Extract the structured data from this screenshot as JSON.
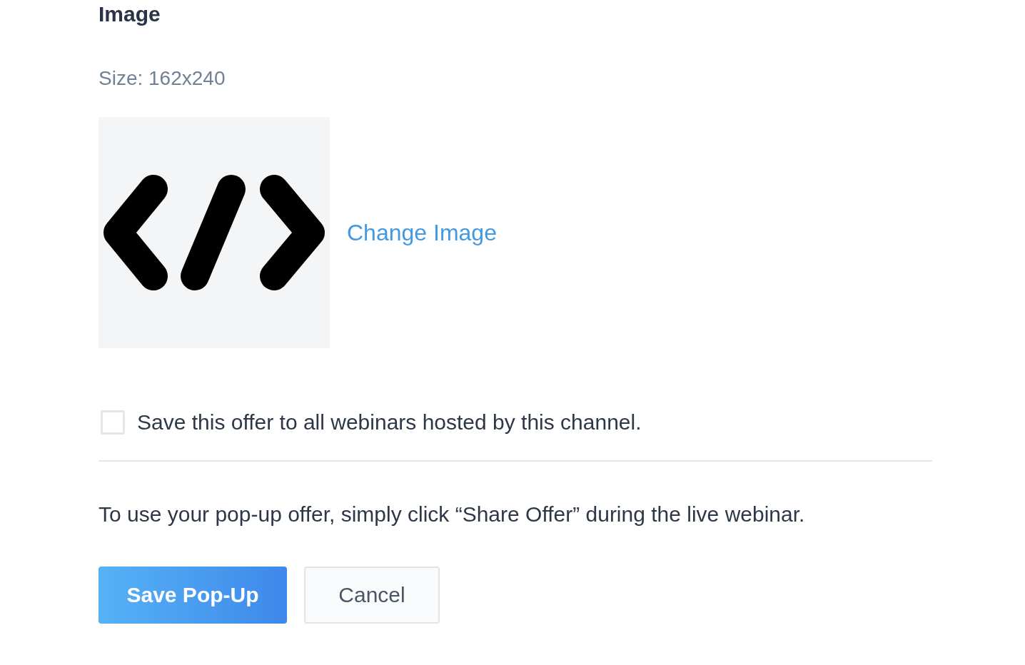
{
  "section": {
    "title": "Image",
    "size_hint": "Size: 162x240"
  },
  "image": {
    "action": "Change Image"
  },
  "option": {
    "label": "Save this offer to all webinars hosted by this channel.",
    "checked": false
  },
  "note": "To use your pop-up offer, simply click “Share Offer” during the live webinar.",
  "buttons": [
    {
      "label": "Save Pop-Up",
      "kind": "primary"
    },
    {
      "label": "Cancel",
      "kind": "secondary"
    }
  ]
}
